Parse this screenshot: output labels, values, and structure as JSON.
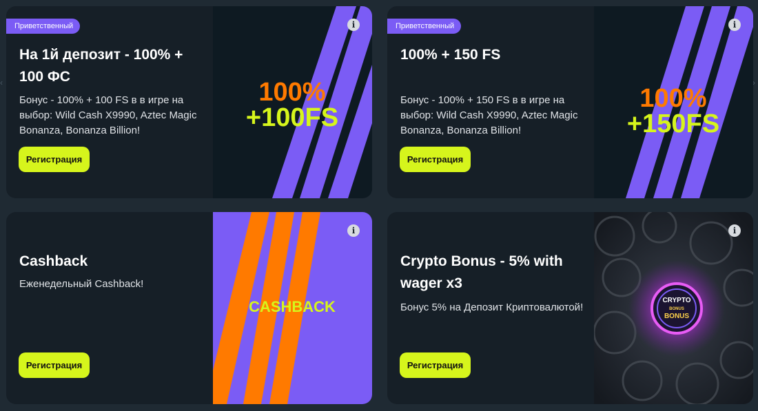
{
  "cards": [
    {
      "badge": "Приветственный",
      "title": "На 1й депозит - 100% + 100 ФС",
      "description": "Бонус - 100% + 100 FS в в игре на выбор: Wild Cash X9990, Aztec Magic Bonanza, Bonanza Billion!",
      "button": "Регистрация",
      "art_line1": "100%",
      "art_line2": "+100FS"
    },
    {
      "badge": "Приветственный",
      "title": "100% + 150 FS",
      "description": "Бонус - 100% + 150 FS в в игре на выбор: Wild Cash X9990, Aztec Magic Bonanza, Bonanza Billion!",
      "button": "Регистрация",
      "art_line1": "100%",
      "art_line2": "+150FS"
    },
    {
      "title": "Cashback",
      "description": "Еженедельный Cashback!",
      "button": "Регистрация",
      "art_text": "CASHBACK"
    },
    {
      "title": "Crypto Bonus - 5% with wager x3",
      "description": "Бонус 5% на Депозит Криптовалютой!",
      "button": "Регистрация",
      "coin_line1": "CRYPTO",
      "coin_line2": "BONUS",
      "coin_line3": "BONUS"
    }
  ],
  "info_icon": "info-icon",
  "colors": {
    "background": "#1f2a33",
    "card": "#161f27",
    "accent_purple": "#7b5cf5",
    "accent_lime": "#d6f51c",
    "accent_orange": "#ff7a00"
  }
}
